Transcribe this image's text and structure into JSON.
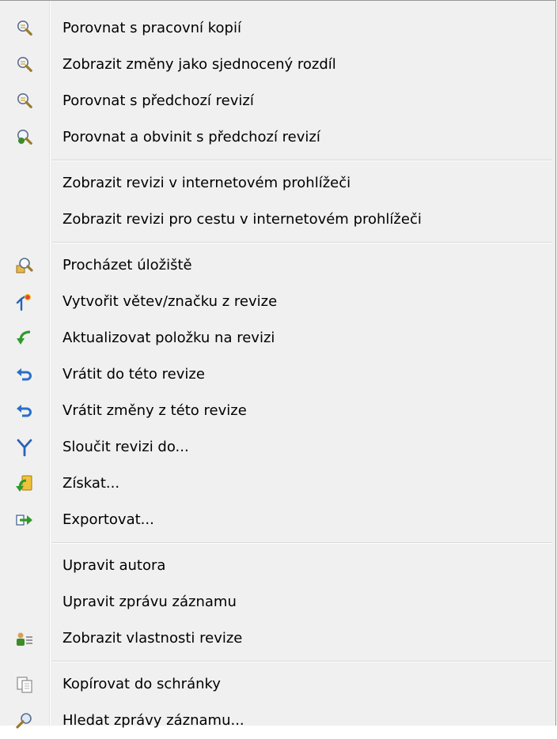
{
  "menu": {
    "groups": [
      {
        "items": [
          {
            "label": "Porovnat s pracovní kopií",
            "icon": "compare-magnifier-icon"
          },
          {
            "label": "Zobrazit změny jako sjednocený rozdíl",
            "icon": "compare-magnifier-icon"
          },
          {
            "label": "Porovnat s předchozí revizí",
            "icon": "compare-magnifier-icon"
          },
          {
            "label": "Porovnat a obvinit s předchozí revizí",
            "icon": "blame-magnifier-icon"
          }
        ]
      },
      {
        "items": [
          {
            "label": "Zobrazit revizi v internetovém prohlížeči",
            "icon": ""
          },
          {
            "label": "Zobrazit revizi pro cestu v internetovém prohlížeči",
            "icon": ""
          }
        ]
      },
      {
        "items": [
          {
            "label": "Procházet úložiště",
            "icon": "repo-browser-icon"
          },
          {
            "label": "Vytvořit větev/značku z revize",
            "icon": "branch-tag-icon"
          },
          {
            "label": "Aktualizovat položku na revizi",
            "icon": "update-arrow-icon"
          },
          {
            "label": "Vrátit do této revize",
            "icon": "revert-arrow-icon"
          },
          {
            "label": "Vrátit změny z této revize",
            "icon": "revert-arrow-icon"
          },
          {
            "label": "Sloučit revizi do...",
            "icon": "merge-icon"
          },
          {
            "label": "Získat...",
            "icon": "checkout-icon"
          },
          {
            "label": "Exportovat...",
            "icon": "export-icon"
          }
        ]
      },
      {
        "items": [
          {
            "label": "Upravit autora",
            "icon": ""
          },
          {
            "label": "Upravit zprávu záznamu",
            "icon": ""
          },
          {
            "label": "Zobrazit vlastnosti revize",
            "icon": "properties-icon"
          }
        ]
      },
      {
        "items": [
          {
            "label": "Kopírovat do schránky",
            "icon": "copy-clipboard-icon"
          },
          {
            "label": "Hledat zprávy záznamu...",
            "icon": "search-log-icon"
          }
        ]
      }
    ]
  }
}
